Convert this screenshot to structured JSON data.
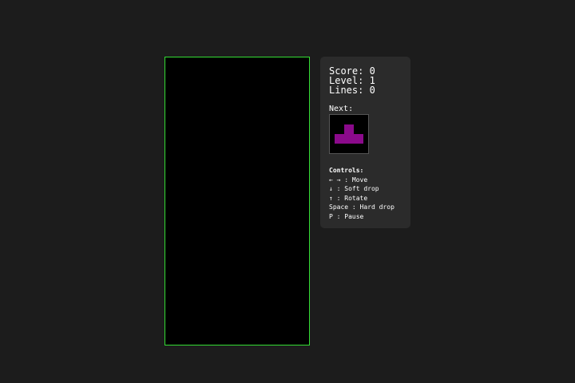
{
  "board": {
    "border_color": "#33dd33",
    "background": "#000000"
  },
  "stats": {
    "score": "Score: 0",
    "level": "Level: 1",
    "lines": "Lines: 0"
  },
  "next": {
    "label": "Next:",
    "piece": "T",
    "color": "#8b0a8b"
  },
  "controls": {
    "title": "Controls:",
    "items": [
      "← → : Move",
      "↓ : Soft drop",
      "↑ : Rotate",
      "Space : Hard drop",
      "P : Pause"
    ]
  }
}
